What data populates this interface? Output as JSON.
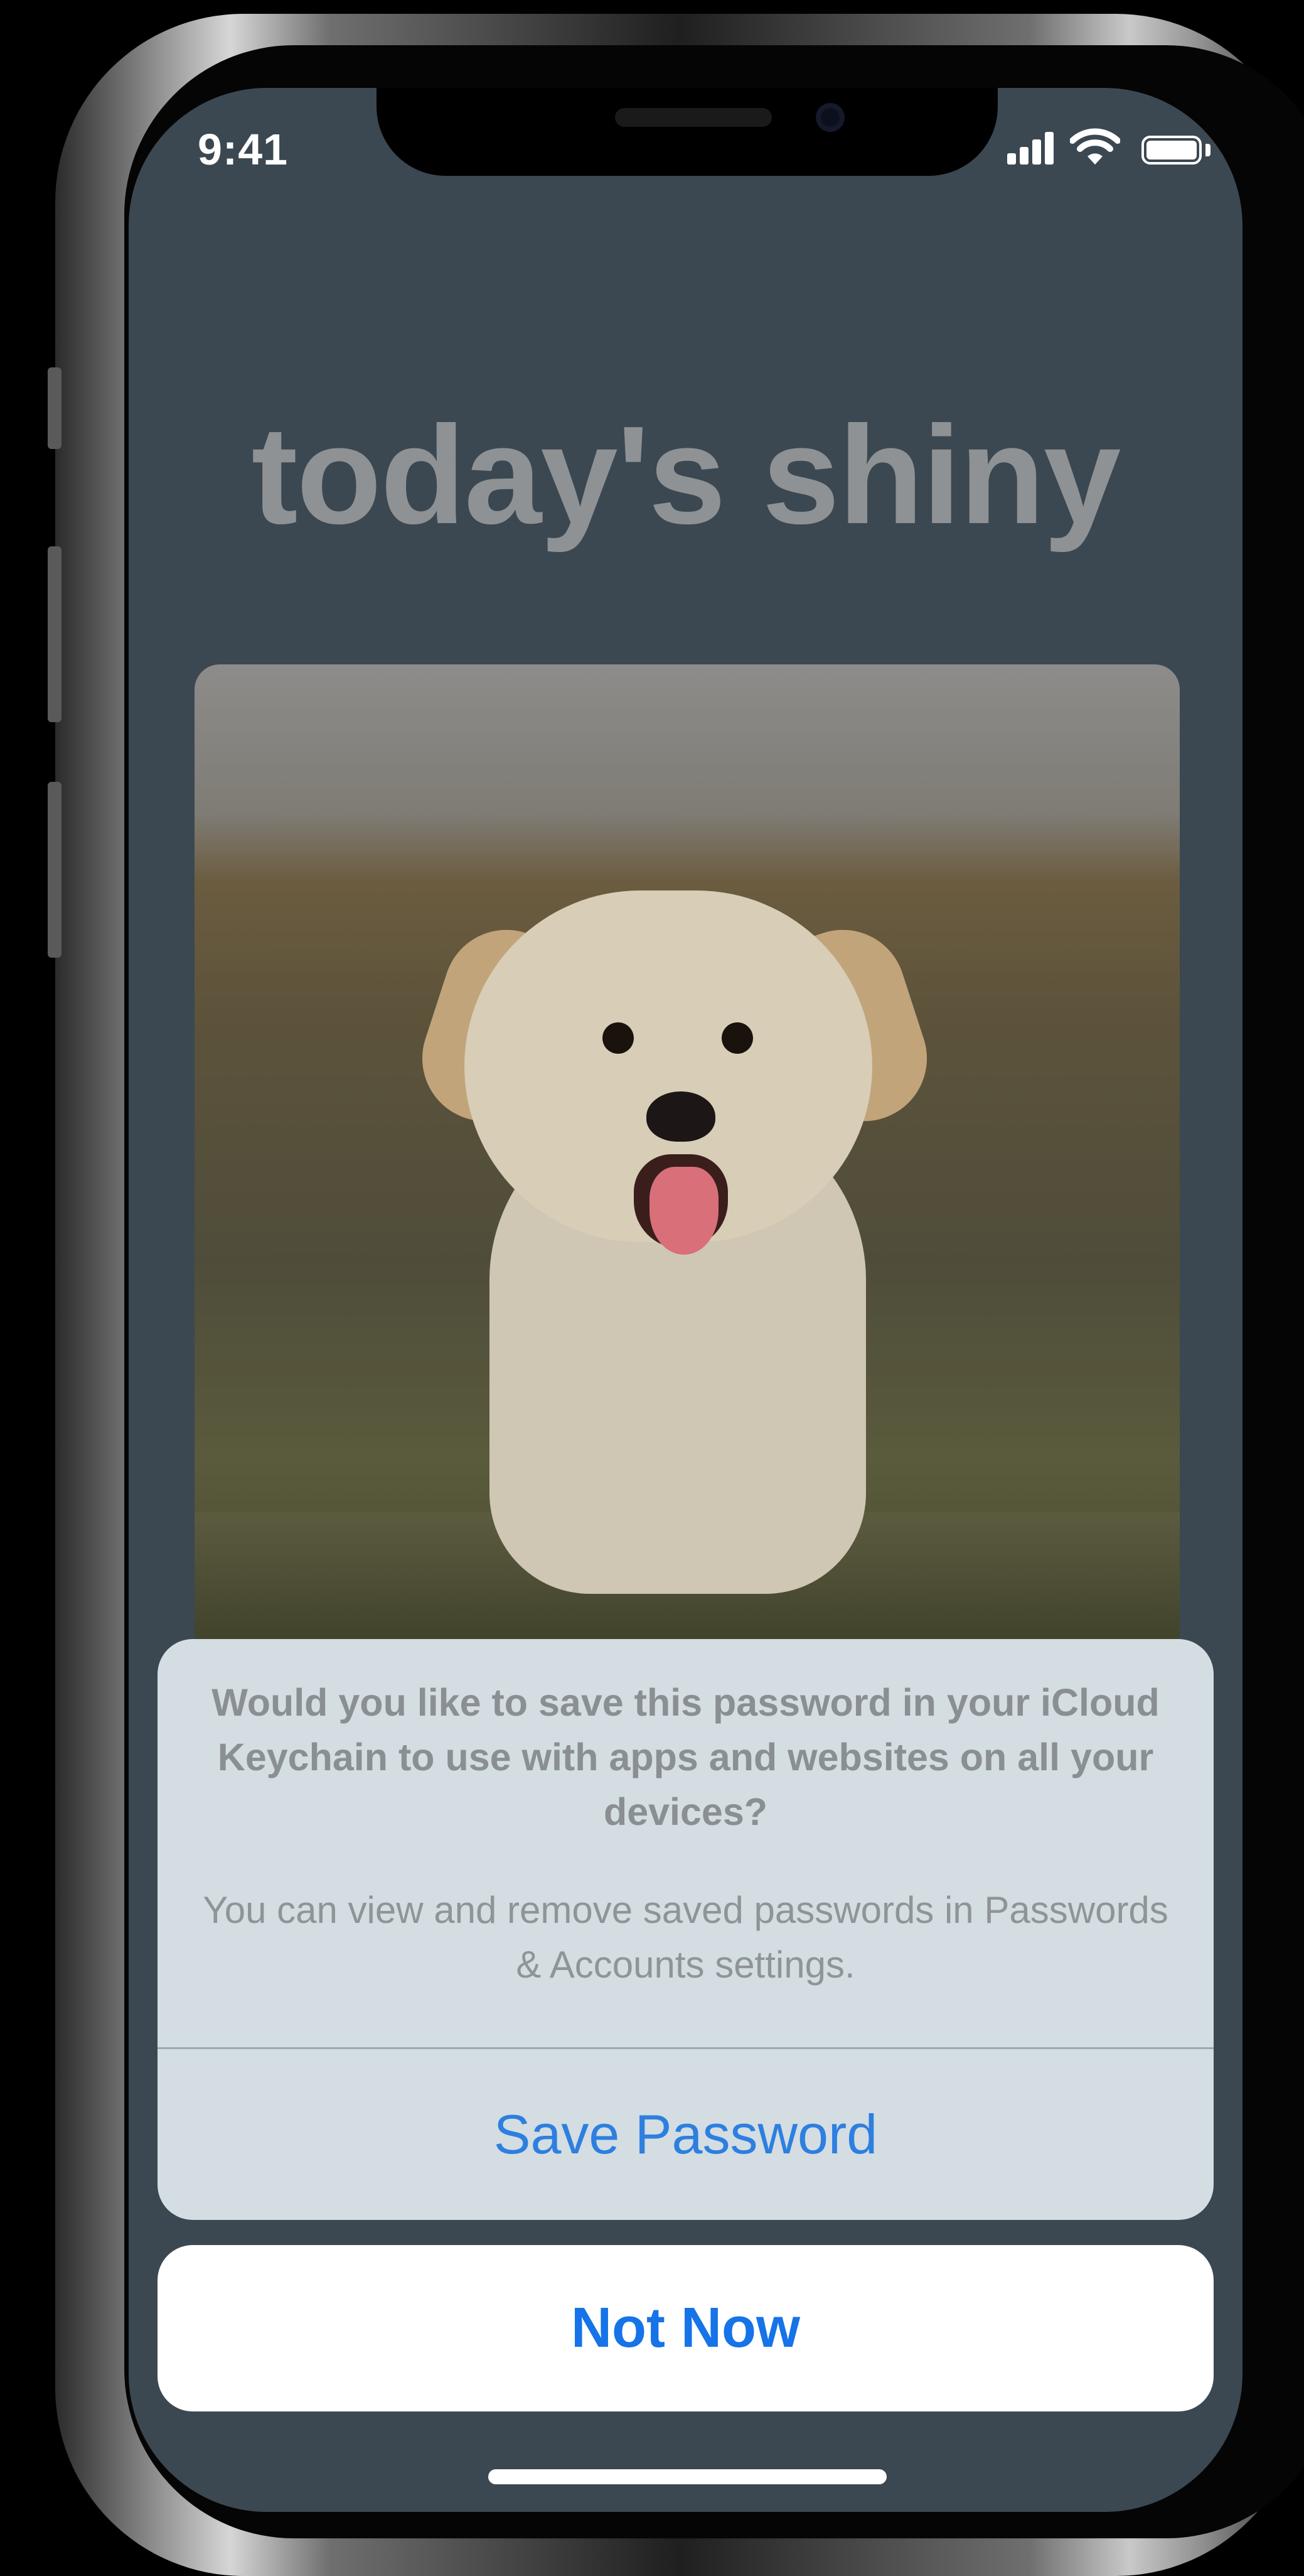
{
  "status_bar": {
    "time": "9:41",
    "icons": [
      "cellular-signal-icon",
      "wifi-icon",
      "battery-icon"
    ]
  },
  "app": {
    "title": "today's shiny"
  },
  "hero_image": {
    "icon": "puppy-photo"
  },
  "action_sheet": {
    "title": "Would you like to save this password in your iCloud Keychain to use with apps and websites on all your devices?",
    "message": "You can view and remove saved passwords in Passwords & Accounts settings.",
    "primary_action": "Save Password",
    "cancel_action": "Not Now"
  },
  "colors": {
    "screen_background": "#3b4852",
    "sheet_background": "#d3dde2",
    "action_blue": "#2d7fe0"
  }
}
